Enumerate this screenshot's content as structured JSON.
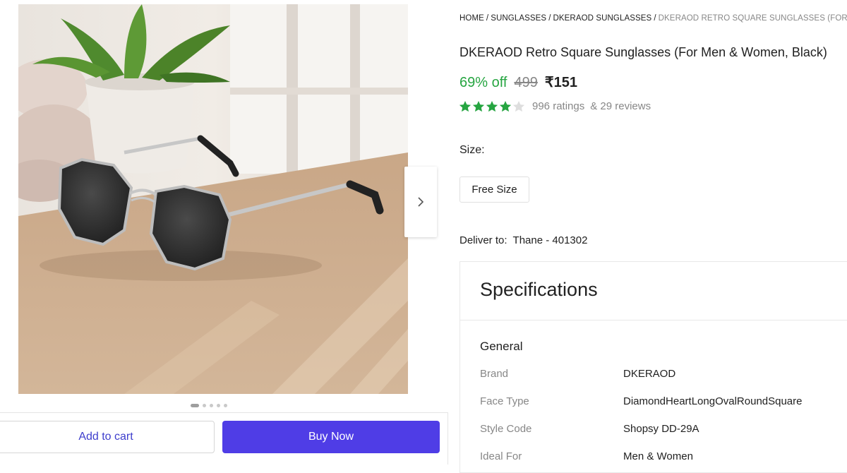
{
  "breadcrumb": [
    "HOME",
    "SUNGLASSES",
    "DKERAOD SUNGLASSES",
    "DKERAOD RETRO SQUARE SUNGLASSES (FOR MEN & WOMEN, BLACK)"
  ],
  "product": {
    "title": "DKERAOD Retro Square Sunglasses (For Men & Women, Black)",
    "discount": "69% off",
    "mrp": "499",
    "price": "₹151",
    "rating_stars": 4,
    "rating_max": 5,
    "ratings": "996 ratings",
    "reviews": "& 29 reviews"
  },
  "size": {
    "label": "Size:",
    "option": "Free Size"
  },
  "delivery": {
    "label": "Deliver to:",
    "location": "Thane - 401302"
  },
  "gallery": {
    "image_count": 5,
    "active_index": 0,
    "next_icon": "chevron-right-icon"
  },
  "actions": {
    "add_to_cart": "Add to cart",
    "buy_now": "Buy Now"
  },
  "specifications": {
    "title": "Specifications",
    "group": "General",
    "rows": [
      {
        "key": "Brand",
        "value": "DKERAOD"
      },
      {
        "key": "Face Type",
        "value": "DiamondHeartLongOvalRoundSquare"
      },
      {
        "key": "Style Code",
        "value": "Shopsy DD-29A"
      },
      {
        "key": "Ideal For",
        "value": "Men & Women"
      }
    ]
  },
  "colors": {
    "discount_green": "#26a541",
    "buy_button": "#4f3de6",
    "cart_text": "#3d3dcc",
    "star_green": "#26a541",
    "muted_text": "#878787"
  }
}
